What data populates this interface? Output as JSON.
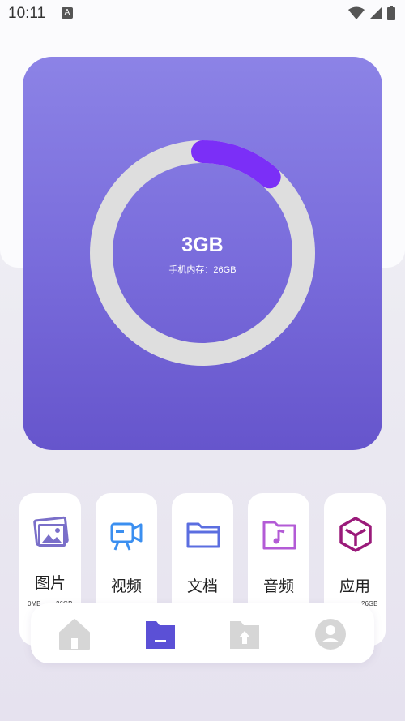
{
  "status_bar": {
    "time": "10:11",
    "notification_icon": "a-letter-icon",
    "icons": [
      "wifi-icon",
      "cell-signal-icon",
      "battery-icon"
    ]
  },
  "storage": {
    "used": "3GB",
    "total_label": "手机内存：26GB",
    "used_fraction": 0.115,
    "colors": {
      "track": "#dedede",
      "progress": "#7b2ff7",
      "card_top": "#8c83e6",
      "card_bottom": "#6655cc"
    }
  },
  "categories": [
    {
      "label": "图片",
      "icon": "image-icon",
      "color": "#7a6fc9",
      "size_left": "0MB",
      "size_right": "26GB"
    },
    {
      "label": "视频",
      "icon": "video-camera-icon",
      "color": "#3b8ff0"
    },
    {
      "label": "文档",
      "icon": "folder-icon",
      "color": "#5b6ee0"
    },
    {
      "label": "音频",
      "icon": "music-file-icon",
      "color": "#b35bd6"
    },
    {
      "label": "应用",
      "icon": "cube-icon",
      "color": "#9a1a7a",
      "size_right": "26GB"
    }
  ],
  "bottom_nav": {
    "items": [
      {
        "name": "home",
        "icon": "home-icon",
        "active": false
      },
      {
        "name": "files",
        "icon": "folder-icon",
        "active": true
      },
      {
        "name": "upload",
        "icon": "folder-upload-icon",
        "active": false
      },
      {
        "name": "profile",
        "icon": "user-icon",
        "active": false
      }
    ],
    "active_color": "#5b50d6",
    "inactive_color": "#d6d6d6"
  }
}
